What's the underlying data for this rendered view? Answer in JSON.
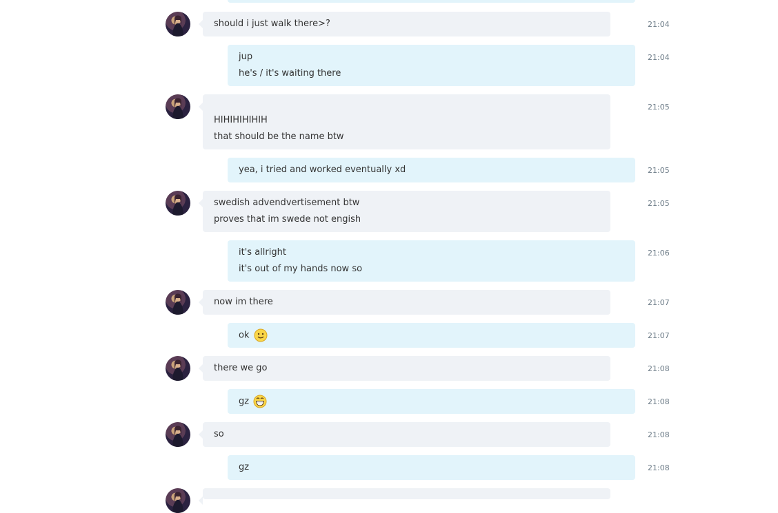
{
  "messages": [
    {
      "from": "them",
      "lines": [
        "should i just walk there>?"
      ],
      "time": "21:04"
    },
    {
      "from": "me",
      "lines": [
        "jup",
        "he's / it's waiting there"
      ],
      "time": "21:04"
    },
    {
      "from": "them",
      "lines": [
        "HIHIHIHIHIH",
        "that should be the name btw"
      ],
      "time": "21:05"
    },
    {
      "from": "me",
      "lines": [
        "yea, i tried and worked eventually xd"
      ],
      "time": "21:05"
    },
    {
      "from": "them",
      "lines": [
        "swedish advendvertisement btw",
        "proves that im swede not engish"
      ],
      "time": "21:05"
    },
    {
      "from": "me",
      "lines": [
        "it's allright",
        "it's out of my hands now so"
      ],
      "time": "21:06"
    },
    {
      "from": "them",
      "lines": [
        "now im there"
      ],
      "time": "21:07"
    },
    {
      "from": "me",
      "lines": [
        "ok"
      ],
      "emoji": "smile-emoji",
      "time": "21:07"
    },
    {
      "from": "them",
      "lines": [
        "there we go"
      ],
      "time": "21:08"
    },
    {
      "from": "me",
      "lines": [
        "gz"
      ],
      "emoji": "grin-emoji",
      "time": "21:08"
    },
    {
      "from": "them",
      "lines": [
        "so"
      ],
      "time": "21:08"
    },
    {
      "from": "me",
      "lines": [
        "gz"
      ],
      "time": "21:08"
    }
  ],
  "colors": {
    "incoming_bubble": "#eff2f6",
    "outgoing_bubble": "#e2f4fb",
    "timestamp": "#6b7a86"
  }
}
